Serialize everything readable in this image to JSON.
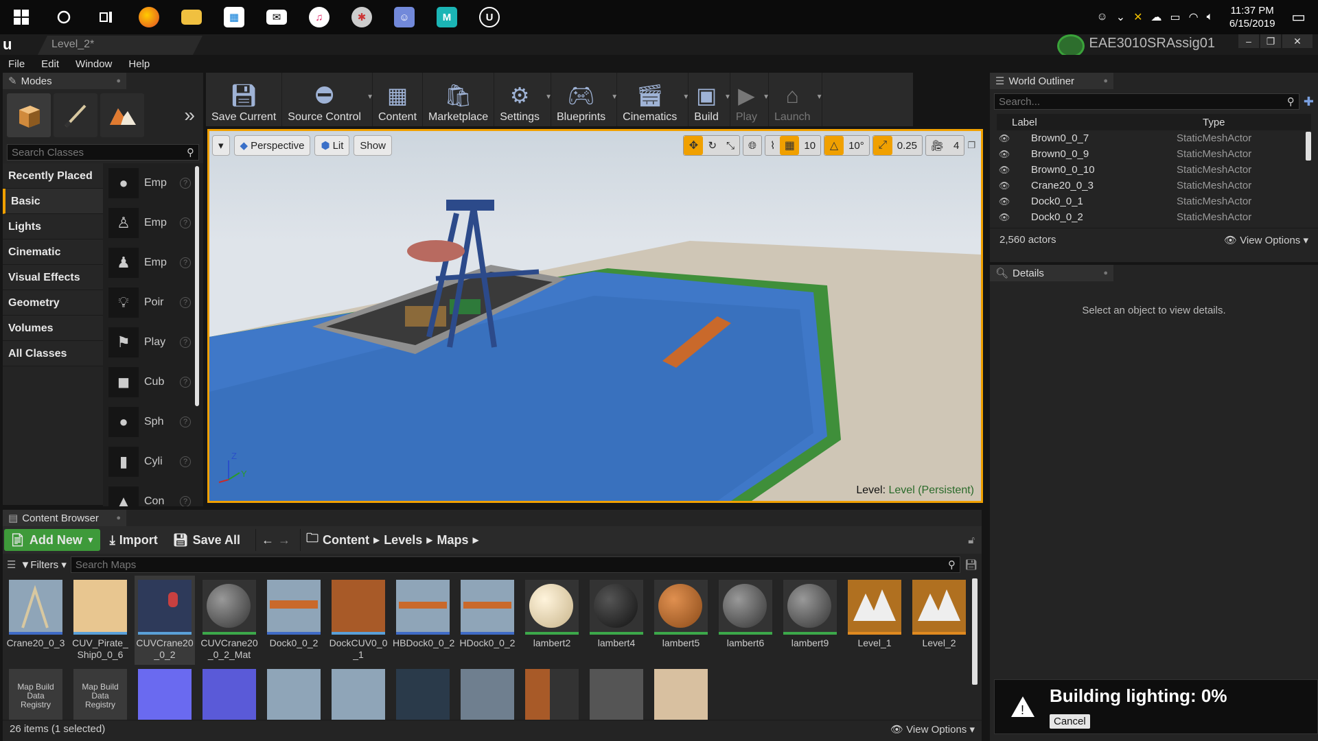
{
  "taskbar": {
    "apps": [
      "windows-start",
      "search",
      "task-view",
      "firefox",
      "file-explorer",
      "store",
      "mail",
      "itunes",
      "paint",
      "discord",
      "maya",
      "unreal"
    ],
    "clock_time": "11:37 PM",
    "clock_date": "6/15/2019"
  },
  "titlebar": {
    "doc_tab": "Level_2*",
    "project": "EAE3010SRAssig01"
  },
  "menu": [
    "File",
    "Edit",
    "Window",
    "Help"
  ],
  "modes": {
    "tab": "Modes",
    "search_placeholder": "Search Classes",
    "categories": [
      "Recently Placed",
      "Basic",
      "Lights",
      "Cinematic",
      "Visual Effects",
      "Geometry",
      "Volumes",
      "All Classes"
    ],
    "selected_category": "Basic",
    "items": [
      "Emp",
      "Emp",
      "Emp",
      "Poir",
      "Play",
      "Cub",
      "Sph",
      "Cyli",
      "Con"
    ]
  },
  "toolbar": {
    "buttons": [
      "Save Current",
      "Source Control",
      "Content",
      "Marketplace",
      "Settings",
      "Blueprints",
      "Cinematics",
      "Build",
      "Play",
      "Launch"
    ]
  },
  "viewport": {
    "perspective": "Perspective",
    "lit": "Lit",
    "show": "Show",
    "grid_snap": "10",
    "rot_snap": "10°",
    "scale_snap": "0.25",
    "cam_speed": "4",
    "level_label": "Level:",
    "level_name": "Level (Persistent)",
    "axis_z": "Z",
    "axis_y": "Y"
  },
  "outliner": {
    "tab": "World Outliner",
    "search_placeholder": "Search...",
    "col_label": "Label",
    "col_type": "Type",
    "rows": [
      {
        "label": "Brown0_0_7",
        "type": "StaticMeshActor"
      },
      {
        "label": "Brown0_0_9",
        "type": "StaticMeshActor"
      },
      {
        "label": "Brown0_0_10",
        "type": "StaticMeshActor"
      },
      {
        "label": "Crane20_0_3",
        "type": "StaticMeshActor"
      },
      {
        "label": "Dock0_0_1",
        "type": "StaticMeshActor"
      },
      {
        "label": "Dock0_0_2",
        "type": "StaticMeshActor"
      }
    ],
    "count": "2,560 actors",
    "view_options": "View Options"
  },
  "details": {
    "tab": "Details",
    "empty": "Select an object to view details."
  },
  "lighting": {
    "message": "Building lighting:  0%",
    "cancel": "Cancel"
  },
  "content_browser": {
    "tab": "Content Browser",
    "add_new": "Add New",
    "import": "Import",
    "save_all": "Save All",
    "path": [
      "Content",
      "Levels",
      "Maps"
    ],
    "filters": "Filters",
    "search_placeholder": "Search Maps",
    "assets": [
      {
        "name": "Crane20_0_3"
      },
      {
        "name": "CUV_Pirate_\nShip0_0_6"
      },
      {
        "name": "CUVCrane20\n_0_2"
      },
      {
        "name": "CUVCrane20\n_0_2_Mat"
      },
      {
        "name": "Dock0_0_2"
      },
      {
        "name": "DockCUV0_0\n_1"
      },
      {
        "name": "HBDock0_0_2"
      },
      {
        "name": "HDock0_0_2"
      },
      {
        "name": "lambert2"
      },
      {
        "name": "lambert4"
      },
      {
        "name": "lambert5"
      },
      {
        "name": "lambert6"
      },
      {
        "name": "lambert9"
      },
      {
        "name": "Level_1"
      },
      {
        "name": "Level_2"
      }
    ],
    "row2_labels": [
      "Map Build\nData\nRegistry",
      "Map Build\nData\nRegistry"
    ],
    "status": "26 items (1 selected)",
    "view_options": "View Options"
  }
}
